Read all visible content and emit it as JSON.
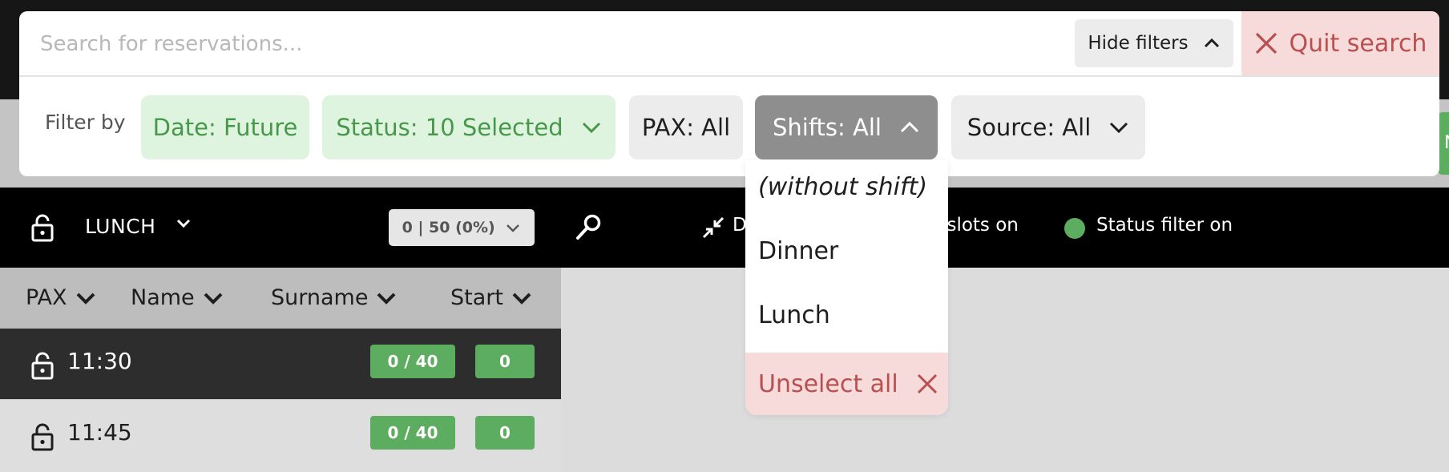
{
  "search": {
    "placeholder": "Search for reservations...",
    "hide_filters_label": "Hide filters",
    "quit_search_label": "Quit search"
  },
  "filters": {
    "label": "Filter by",
    "date": "Date: Future",
    "status": "Status: 10 Selected",
    "pax": "PAX: All",
    "shifts": "Shifts: All",
    "source": "Source: All"
  },
  "shifts_dropdown": {
    "options": [
      "(without shift)",
      "Dinner",
      "Lunch"
    ],
    "unselect_all_label": "Unselect all"
  },
  "shift_bar": {
    "shift_name": "LUNCH",
    "capacity": "0 | 50 (0%)",
    "legend_d": "D",
    "legend_slots": "e slots on",
    "legend_status": "Status filter on"
  },
  "table": {
    "columns": [
      "PAX",
      "Name",
      "Surname",
      "Start"
    ],
    "rows": [
      {
        "time": "11:30",
        "capacity": "0 / 40",
        "count": "0"
      },
      {
        "time": "11:45",
        "capacity": "0 / 40",
        "count": "0"
      }
    ]
  },
  "edge_partial": "N",
  "colors": {
    "accent_green": "#5cad5f",
    "chip_green_bg": "#dff4df",
    "danger_red": "#b94f4f",
    "danger_bg": "#f7dada"
  }
}
